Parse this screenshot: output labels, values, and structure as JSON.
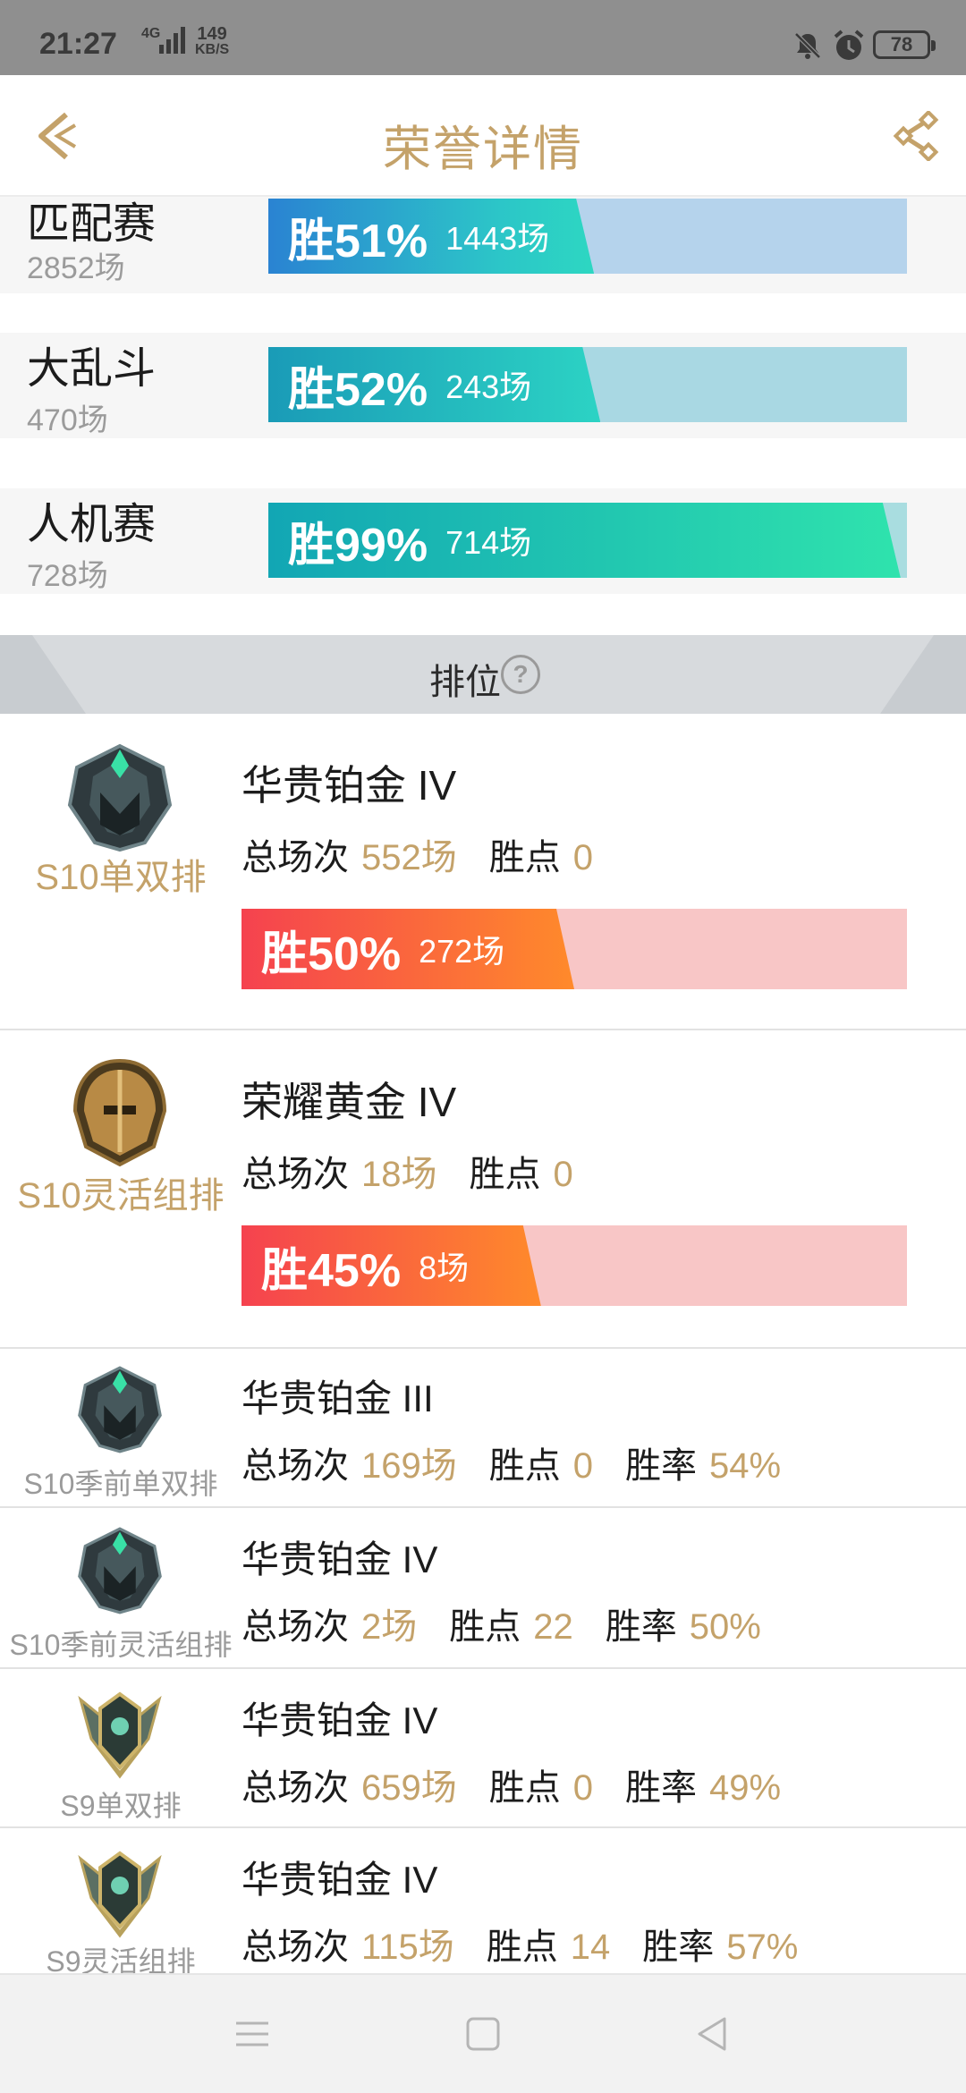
{
  "status_bar": {
    "time": "21:27",
    "network": "4G",
    "speed_value": "149",
    "speed_unit": "KB/S",
    "battery": "78"
  },
  "header": {
    "title": "荣誉详情",
    "back_icon": "back-chevron-icon",
    "share_icon": "share-icon"
  },
  "modes": [
    {
      "name": "匹配赛",
      "count": "2852场",
      "win_label": "胜51%",
      "win_rate": 0.51,
      "games": "1443场"
    },
    {
      "name": "大乱斗",
      "count": "470场",
      "win_label": "胜52%",
      "win_rate": 0.52,
      "games": "243场"
    },
    {
      "name": "人机赛",
      "count": "728场",
      "win_label": "胜99%",
      "win_rate": 0.99,
      "games": "714场"
    }
  ],
  "ranked": {
    "title": "排位",
    "help_icon": "?",
    "labels": {
      "total": "总场次",
      "points": "胜点",
      "rate": "胜率"
    },
    "seasons_main": [
      {
        "season": "S10单双排",
        "rank": "华贵铂金 IV",
        "total": "552场",
        "points": "0",
        "win_label": "胜50%",
        "win_rate": 0.5,
        "games": "272场"
      },
      {
        "season": "S10灵活组排",
        "rank": "荣耀黄金 IV",
        "total": "18场",
        "points": "0",
        "win_label": "胜45%",
        "win_rate": 0.45,
        "games": "8场"
      }
    ],
    "seasons_history": [
      {
        "season": "S10季前单双排",
        "rank": "华贵铂金 III",
        "total": "169场",
        "points": "0",
        "rate": "54%"
      },
      {
        "season": "S10季前灵活组排",
        "rank": "华贵铂金 IV",
        "total": "2场",
        "points": "22",
        "rate": "50%"
      },
      {
        "season": "S9单双排",
        "rank": "华贵铂金 IV",
        "total": "659场",
        "points": "0",
        "rate": "49%"
      },
      {
        "season": "S9灵活组排",
        "rank": "华贵铂金 IV",
        "total": "115场",
        "points": "14",
        "rate": "57%"
      }
    ]
  },
  "navbar": {
    "menu_icon": "menu-icon",
    "home_icon": "home-square-icon",
    "back_icon": "back-triangle-icon"
  },
  "colors": {
    "gold": "#c4a26a",
    "blue": "#2d8fd6",
    "teal": "#2fd3c0",
    "red": "#f44a52",
    "orange": "#ff8a2a"
  }
}
